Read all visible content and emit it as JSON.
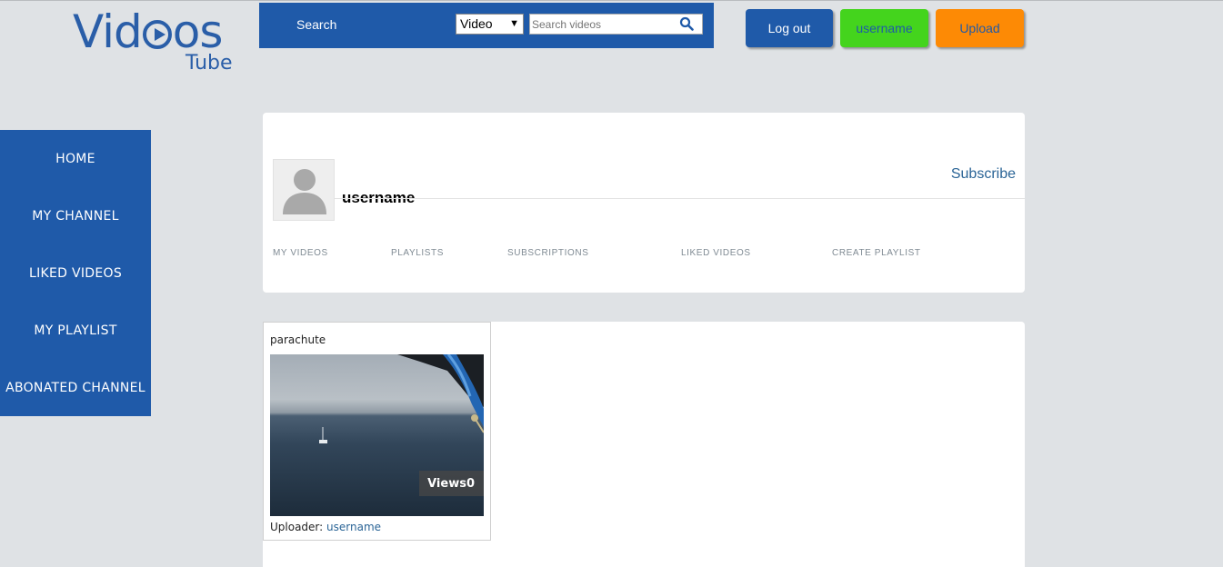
{
  "logo": {
    "main_left": "Vid",
    "main_right": "os",
    "sub": "Tube"
  },
  "search": {
    "label": "Search",
    "type_selected": "Video",
    "placeholder": "Search videos"
  },
  "header_buttons": {
    "logout": "Log out",
    "user": "username",
    "upload": "Upload"
  },
  "sidebar": {
    "items": [
      {
        "label": "HOME"
      },
      {
        "label": "MY CHANNEL"
      },
      {
        "label": "LIKED VIDEOS"
      },
      {
        "label": "MY PLAYLIST"
      },
      {
        "label": "ABONATED CHANNEL"
      }
    ]
  },
  "profile": {
    "username": "username",
    "subscribe_label": "Subscribe",
    "tabs": [
      {
        "label": "MY VIDEOS"
      },
      {
        "label": "PLAYLISTS"
      },
      {
        "label": "SUBSCRIPTIONS"
      },
      {
        "label": "LIKED VIDEOS"
      },
      {
        "label": "CREATE PLAYLIST"
      }
    ]
  },
  "videos": [
    {
      "title": "parachute",
      "views_label": "Views0",
      "uploader_label": "Uploader:",
      "uploader_name": "username"
    }
  ],
  "colors": {
    "brand_blue": "#1f5aa9",
    "green": "#44d41d",
    "orange": "#fd8a05",
    "link": "#2a6496",
    "page_bg": "#dfe2e5"
  }
}
